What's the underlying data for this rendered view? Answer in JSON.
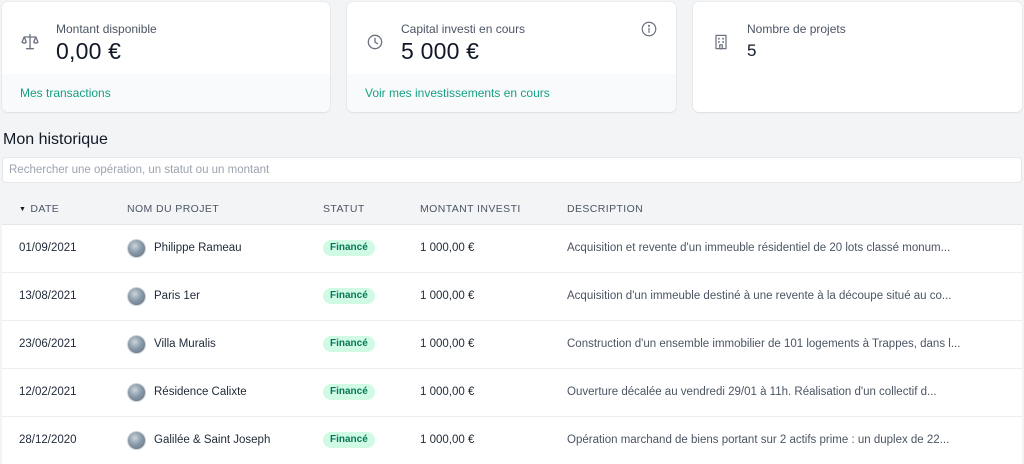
{
  "cards": [
    {
      "label": "Montant disponible",
      "value": "0,00 €",
      "link": "Mes transactions",
      "icon": "scale-icon"
    },
    {
      "label": "Capital investi en cours",
      "value": "5 000 €",
      "link": "Voir mes investissements en cours",
      "icon": "clock-icon",
      "info_icon": "info-icon"
    },
    {
      "label": "Nombre de projets",
      "value": "5",
      "icon": "building-icon"
    }
  ],
  "history": {
    "title": "Mon historique",
    "search_placeholder": "Rechercher une opération, un statut ou un montant",
    "columns": [
      "DATE",
      "NOM DU PROJET",
      "STATUT",
      "MONTANT INVESTI",
      "DESCRIPTION"
    ],
    "sort_indicator": "▼",
    "rows": [
      {
        "date": "01/09/2021",
        "project": "Philippe Rameau",
        "status": "Financé",
        "amount": "1 000,00 €",
        "description": "Acquisition et revente d'un immeuble résidentiel de 20 lots classé monum..."
      },
      {
        "date": "13/08/2021",
        "project": "Paris 1er",
        "status": "Financé",
        "amount": "1 000,00 €",
        "description": "Acquisition d'un immeuble destiné à une revente à la découpe situé au co..."
      },
      {
        "date": "23/06/2021",
        "project": "Villa Muralis",
        "status": "Financé",
        "amount": "1 000,00 €",
        "description": "Construction d'un ensemble immobilier de 101 logements à Trappes, dans l..."
      },
      {
        "date": "12/02/2021",
        "project": "Résidence Calixte",
        "status": "Financé",
        "amount": "1 000,00 €",
        "description": "Ouverture décalée au vendredi 29/01 à 11h. Réalisation d'un collectif d..."
      },
      {
        "date": "28/12/2020",
        "project": "Galilée & Saint Joseph",
        "status": "Financé",
        "amount": "1 000,00 €",
        "description": "Opération marchand de biens portant sur 2 actifs prime : un duplex de 22..."
      }
    ]
  },
  "colors": {
    "accent_link": "#16a085",
    "badge_bg": "#d1fae5",
    "badge_text": "#047857",
    "page_bg": "#f3f4f6"
  }
}
